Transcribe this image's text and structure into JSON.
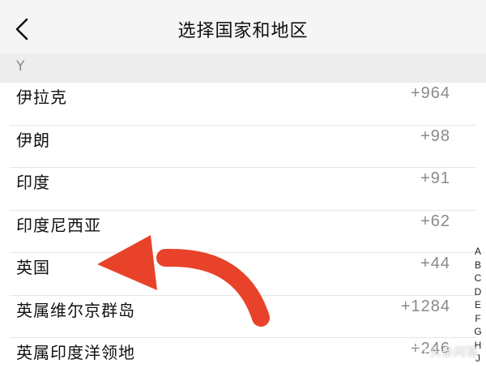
{
  "header": {
    "title": "选择国家和地区"
  },
  "section": {
    "letter": "Y"
  },
  "countries": [
    {
      "name": "伊拉克",
      "code": "+964"
    },
    {
      "name": "伊朗",
      "code": "+98"
    },
    {
      "name": "印度",
      "code": "+91"
    },
    {
      "name": "印度尼西亚",
      "code": "+62"
    },
    {
      "name": "英国",
      "code": "+44"
    },
    {
      "name": "英属维尔京群岛",
      "code": "+1284"
    },
    {
      "name": "英属印度洋领地",
      "code": "+246"
    }
  ],
  "index_letters": [
    "A",
    "B",
    "C",
    "D",
    "E",
    "F",
    "G",
    "H",
    "J"
  ],
  "watermark": {
    "text": "头条问答"
  },
  "colors": {
    "arrow": "#e8432a",
    "header_bg": "#f5f5f5",
    "section_bg": "#ededed"
  }
}
